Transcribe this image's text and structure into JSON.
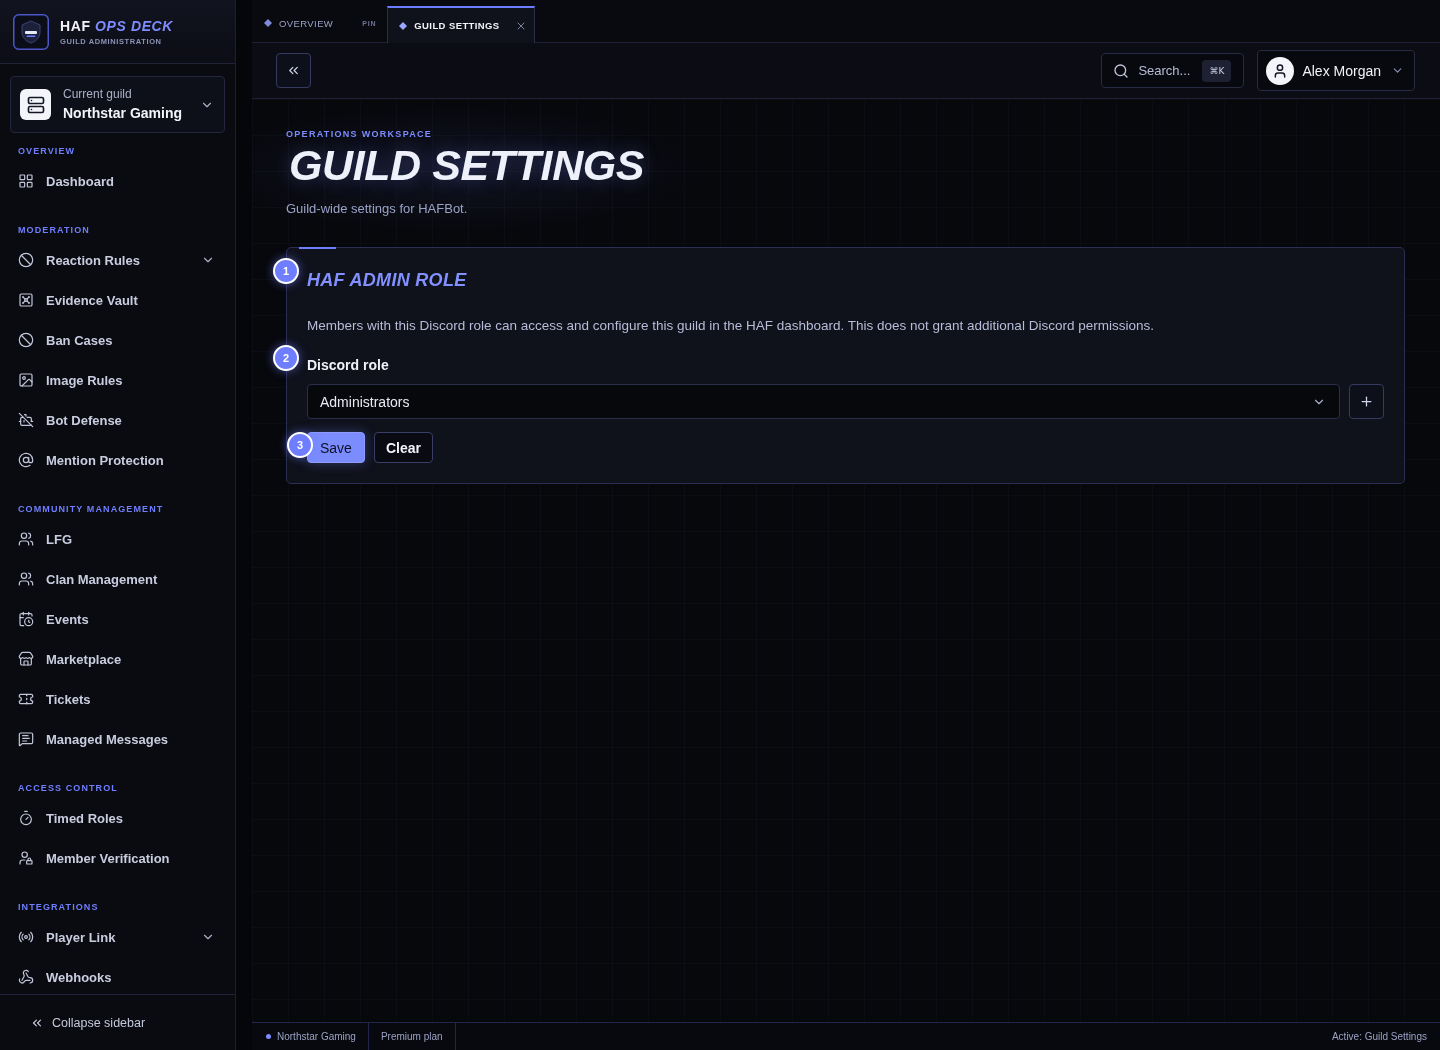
{
  "sidebar": {
    "brand": {
      "title": "HAF *OPS DECK*",
      "subtitle": "GUILD ADMINISTRATION"
    },
    "guild_picker": {
      "label": "Current guild",
      "value": "Northstar Gaming"
    },
    "sections": [
      {
        "title": "OVERVIEW",
        "items": [
          {
            "label": "Dashboard",
            "selected": false,
            "expandable": false
          }
        ]
      },
      {
        "title": "MODERATION",
        "items": [
          {
            "label": "Reaction Rules",
            "selected": false,
            "expandable": true
          },
          {
            "label": "Evidence Vault",
            "selected": false,
            "expandable": false
          },
          {
            "label": "Ban Cases",
            "selected": false,
            "expandable": false
          },
          {
            "label": "Image Rules",
            "selected": false,
            "expandable": false
          },
          {
            "label": "Bot Defense",
            "selected": false,
            "expandable": false
          },
          {
            "label": "Mention Protection",
            "selected": false,
            "expandable": false
          }
        ]
      },
      {
        "title": "COMMUNITY MANAGEMENT",
        "items": [
          {
            "label": "LFG",
            "selected": false,
            "expandable": false
          },
          {
            "label": "Clan Management",
            "selected": false,
            "expandable": false
          },
          {
            "label": "Events",
            "selected": false,
            "expandable": false
          },
          {
            "label": "Marketplace",
            "selected": false,
            "expandable": false
          },
          {
            "label": "Tickets",
            "selected": false,
            "expandable": false
          },
          {
            "label": "Managed Messages",
            "selected": false,
            "expandable": false
          }
        ]
      },
      {
        "title": "ACCESS CONTROL",
        "items": [
          {
            "label": "Timed Roles",
            "selected": false,
            "expandable": false
          },
          {
            "label": "Member Verification",
            "selected": false,
            "expandable": false
          }
        ]
      },
      {
        "title": "INTEGRATIONS",
        "items": [
          {
            "label": "Player Link",
            "selected": false,
            "expandable": true
          },
          {
            "label": "Webhooks",
            "selected": false,
            "expandable": false
          }
        ]
      }
    ],
    "collapse_button": "Collapse sidebar"
  },
  "tabs": [
    {
      "label": "OVERVIEW",
      "selected": false,
      "pin_label": "PIN",
      "closable": false
    },
    {
      "label": "GUILD SETTINGS",
      "selected": true,
      "closable": true
    }
  ],
  "header": {
    "search": {
      "placeholder": "Search...",
      "shortcut": "⌘K"
    },
    "user": {
      "name": "Alex Morgan"
    }
  },
  "page": {
    "eyebrow": "OPERATIONS WORKSPACE",
    "title": "GUILD SETTINGS",
    "subtitle": "Guild-wide settings for HAFBot."
  },
  "card": {
    "step": "1",
    "title": "HAF ADMIN ROLE",
    "description": "Members with this Discord role can access and configure this guild in the HAF dashboard. This does not grant additional Discord permissions.",
    "field": {
      "step": "2",
      "label": "Discord role",
      "value": "Administrators"
    },
    "actions": [
      {
        "label": "Save",
        "kind": "primary",
        "step": "3"
      },
      {
        "label": "Clear",
        "kind": "secondary"
      }
    ]
  },
  "status_bar": {
    "guild": "Northstar Gaming",
    "plan": "Premium plan",
    "active": "Active: Guild Settings"
  }
}
